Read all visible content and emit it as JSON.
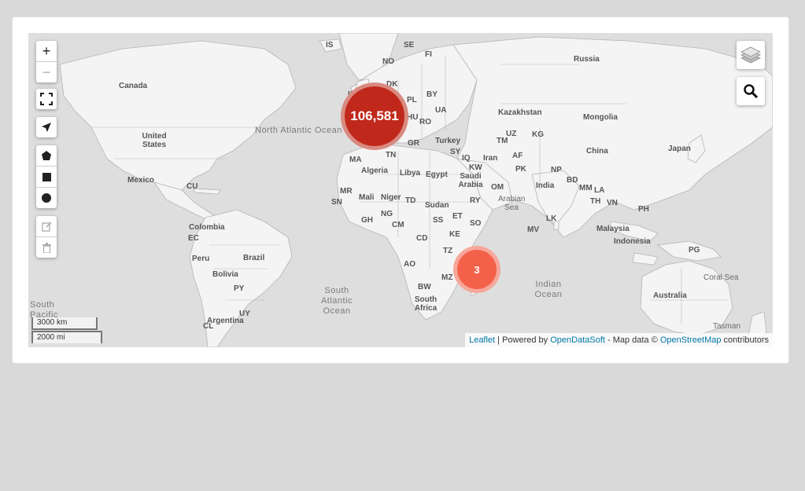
{
  "map": {
    "zoom_in": "+",
    "zoom_out": "−",
    "clusters": [
      {
        "count": "106,581",
        "color": "#c0281b",
        "halo": "#d98a80"
      },
      {
        "count": "3",
        "color": "#f4614a",
        "halo": "#f6a79a"
      }
    ],
    "countries": [
      "IS",
      "NO",
      "SE",
      "FI",
      "Russia",
      "Canada",
      "DK",
      "IE",
      "PL",
      "BY",
      "UA",
      "Kazakhstan",
      "Mongolia",
      "HU",
      "RO",
      "UZ",
      "KG",
      "TM",
      "GR",
      "Turkey",
      "China",
      "Japan",
      "United States",
      "MA",
      "TN",
      "SY",
      "IQ",
      "Iran",
      "AF",
      "Algeria",
      "Libya",
      "Egypt",
      "KW",
      "PK",
      "NP",
      "Saudi Arabia",
      "India",
      "BD",
      "MM",
      "LA",
      "Mexico",
      "CU",
      "MR",
      "Mali",
      "Niger",
      "OM",
      "TH",
      "VN",
      "SN",
      "TD",
      "Sudan",
      "RY",
      "PH",
      "NG",
      "ET",
      "GH",
      "CM",
      "SS",
      "Colombia",
      "KE",
      "EC",
      "LK",
      "MV",
      "Malaysia",
      "CD",
      "SO",
      "Peru",
      "Brazil",
      "Indonesia",
      "PG",
      "TZ",
      "AO",
      "Bolivia",
      "MZ",
      "PY",
      "BW",
      "Australia",
      "South Africa",
      "UY",
      "Argentina",
      "CL"
    ],
    "oceans": {
      "north_atlantic": "North Atlantic Ocean",
      "south_atlantic": "South Atlantic Ocean",
      "south_pacific": "South Pacific",
      "indian": "Indian Ocean",
      "arabian_sea": "Arabian Sea",
      "coral_sea": "Coral Sea",
      "tasman": "Tasman"
    },
    "scale": {
      "km": "3000 km",
      "mi": "2000 mi"
    },
    "attribution": {
      "leaflet": "Leaflet",
      "powered": " | Powered by ",
      "ods": "OpenDataSoft",
      "mapdata": " - Map data © ",
      "osm": "OpenStreetMap",
      "contrib": " contributors"
    },
    "colors": {
      "land": "#f4f4f4",
      "water": "#dedede",
      "border": "#a9a9a9",
      "link": "#0078a8"
    },
    "icons": [
      "zoom-in-icon",
      "zoom-out-icon",
      "fullscreen-icon",
      "locate-icon",
      "polygon-icon",
      "rectangle-icon",
      "circle-icon",
      "edit-icon",
      "delete-icon",
      "layers-icon",
      "search-icon"
    ]
  }
}
